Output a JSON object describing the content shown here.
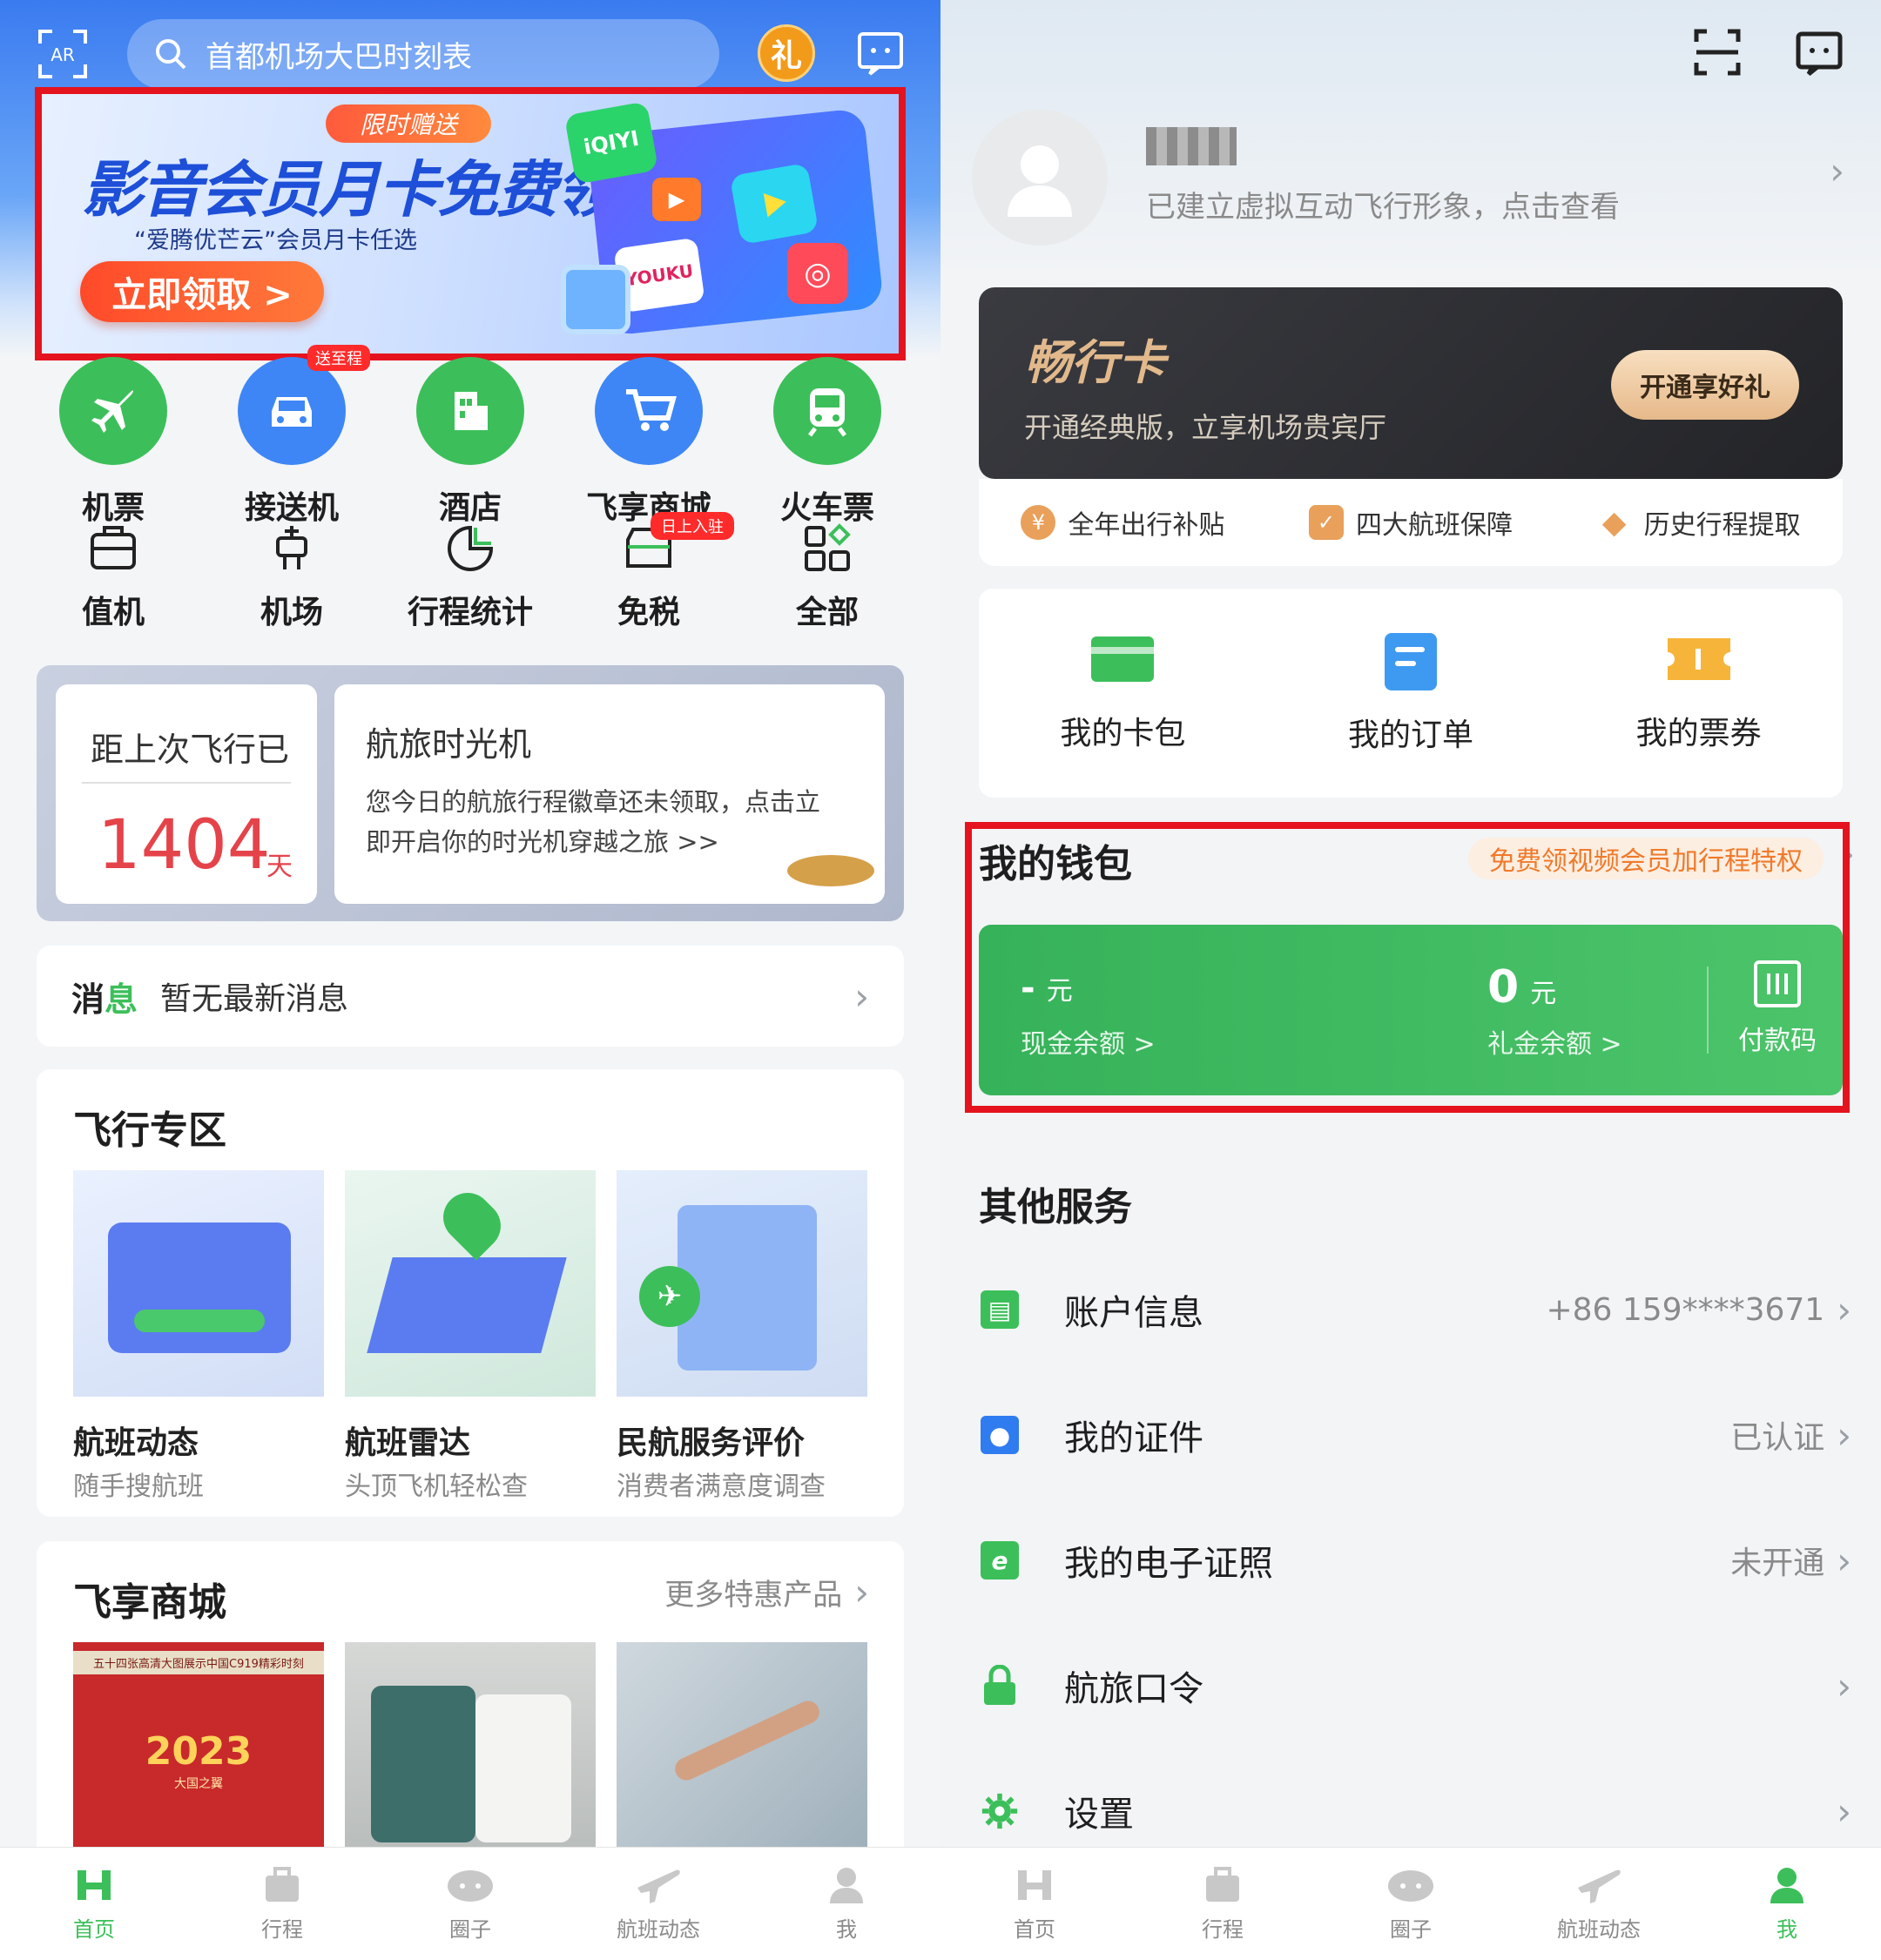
{
  "left": {
    "search": {
      "placeholder": "首都机场大巴时刻表"
    },
    "gift_badge": "礼",
    "banner": {
      "tag": "限时赠送",
      "title": "影音会员月卡免费领",
      "subtitle": "“爱腾优芒云”会员月卡任选",
      "cta": "立即领取 >",
      "apps": [
        "iQIYI",
        "YOUKU"
      ]
    },
    "primary_grid": [
      {
        "label": "机票",
        "icon": "plane-icon",
        "color": "#3cbf5a"
      },
      {
        "label": "接送机",
        "icon": "car-icon",
        "color": "#3e86f5",
        "badge": "送至程"
      },
      {
        "label": "酒店",
        "icon": "hotel-icon",
        "color": "#3cbf5a"
      },
      {
        "label": "飞享商城",
        "icon": "cart-icon",
        "color": "#3e86f5"
      },
      {
        "label": "火车票",
        "icon": "train-icon",
        "color": "#3cbf5a"
      }
    ],
    "secondary_grid": [
      {
        "label": "值机",
        "icon": "checkin-icon"
      },
      {
        "label": "机场",
        "icon": "airport-icon"
      },
      {
        "label": "行程统计",
        "icon": "pie-chart-icon"
      },
      {
        "label": "免税",
        "icon": "dutyfree-icon",
        "badge": "日上入驻"
      },
      {
        "label": "全部",
        "icon": "all-apps-icon"
      }
    ],
    "since_flight": {
      "label": "距上次飞行已",
      "days": "1404",
      "unit": "天"
    },
    "time_machine": {
      "title": "航旅时光机",
      "desc_line1": "您今日的航旅行程徽章还未领取，点击立",
      "desc_line2": "即开启你的时光机穿越之旅 >>"
    },
    "message": {
      "prefix_a": "消",
      "prefix_b": "息",
      "text": "暂无最新消息"
    },
    "flight_zone": {
      "title": "飞行专区",
      "items": [
        {
          "title": "航班动态",
          "sub": "随手搜航班"
        },
        {
          "title": "航班雷达",
          "sub": "头顶飞机轻松查"
        },
        {
          "title": "民航服务评价",
          "sub": "消费者满意度调查"
        }
      ]
    },
    "mall": {
      "title": "飞享商城",
      "more": "更多特惠产品",
      "calendar_caption": "五十四张高清大图展示中国C919精彩时刻",
      "calendar_year": "2023",
      "calendar_sub": "大国之翼"
    },
    "nav": [
      {
        "label": "首页",
        "icon": "home-icon",
        "active": true
      },
      {
        "label": "行程",
        "icon": "trip-icon"
      },
      {
        "label": "圈子",
        "icon": "circle-chat-icon"
      },
      {
        "label": "航班动态",
        "icon": "flight-status-icon"
      },
      {
        "label": "我",
        "icon": "user-icon"
      }
    ]
  },
  "right": {
    "profile": {
      "desc": "已建立虚拟互动飞行形象，点击查看"
    },
    "pass_card": {
      "title": "畅行卡",
      "desc": "开通经典版，立享机场贵宾厅",
      "button": "开通享好礼"
    },
    "perks": [
      {
        "label": "全年出行补贴",
        "icon": "yen-icon"
      },
      {
        "label": "四大航班保障",
        "icon": "shield-check-icon"
      },
      {
        "label": "历史行程提取",
        "icon": "diamond-icon"
      }
    ],
    "quick": [
      {
        "label": "我的卡包",
        "icon": "card-wallet-icon",
        "color": "#3cbf5a"
      },
      {
        "label": "我的订单",
        "icon": "order-icon",
        "color": "#3e9af0"
      },
      {
        "label": "我的票券",
        "icon": "ticket-icon",
        "color": "#f6b53a"
      }
    ],
    "wallet": {
      "title": "我的钱包",
      "promo": "免费领视频会员加行程特权",
      "cash_value": "-",
      "cash_unit": "元",
      "cash_label": "现金余额 >",
      "gift_value": "0",
      "gift_unit": "元",
      "gift_label": "礼金余额 >",
      "pay_code": "付款码"
    },
    "other_services": {
      "title": "其他服务",
      "items": [
        {
          "label": "账户信息",
          "value": "+86 159****3671",
          "icon": "account-info-icon",
          "color": "#3cbf5a"
        },
        {
          "label": "我的证件",
          "value": "已认证",
          "icon": "id-card-icon",
          "color": "#2f7cf0"
        },
        {
          "label": "我的电子证照",
          "value": "未开通",
          "icon": "e-license-icon",
          "color": "#3cbf5a"
        },
        {
          "label": "航旅口令",
          "value": "",
          "icon": "lock-icon",
          "color": "#3cbf5a"
        },
        {
          "label": "设置",
          "value": "",
          "icon": "gear-icon",
          "color": "#3cbf5a"
        }
      ]
    },
    "nav": [
      {
        "label": "首页",
        "icon": "home-icon"
      },
      {
        "label": "行程",
        "icon": "trip-icon"
      },
      {
        "label": "圈子",
        "icon": "circle-chat-icon"
      },
      {
        "label": "航班动态",
        "icon": "flight-status-icon"
      },
      {
        "label": "我",
        "icon": "user-icon",
        "active": true
      }
    ]
  },
  "colors": {
    "accent_green": "#3cbf5a",
    "highlight_red": "#e5131d",
    "nav_inactive": "#8a8a8a"
  }
}
